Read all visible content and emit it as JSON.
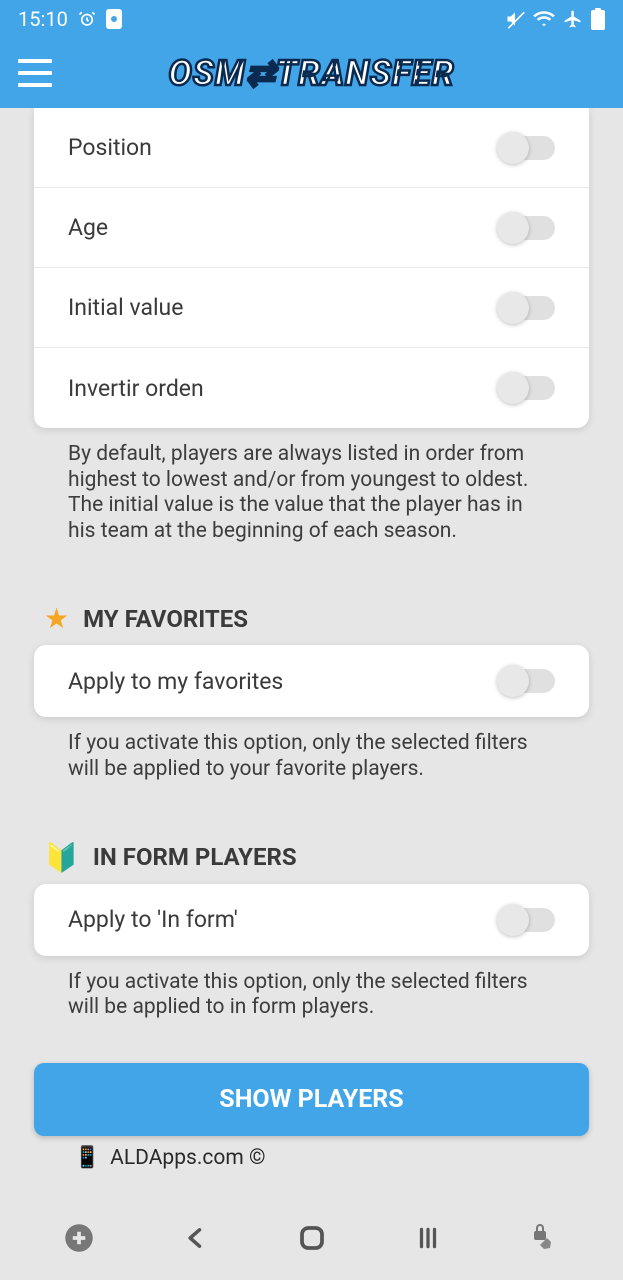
{
  "status": {
    "time": "15:10"
  },
  "app": {
    "title": "OSM⇄TRANSFER"
  },
  "sort": {
    "rows": [
      {
        "label": "Position"
      },
      {
        "label": "Age"
      },
      {
        "label": "Initial value"
      },
      {
        "label": "Invertir orden"
      }
    ],
    "help": "By default, players are always listed in order from highest to lowest and/or from youngest to oldest. The initial value is the value that the player has in his team at the beginning of each season."
  },
  "favorites": {
    "title": "MY FAVORITES",
    "apply_label": "Apply to my favorites",
    "help": "If you activate this option, only the selected filters will be applied to your favorite players."
  },
  "inform": {
    "title": "IN FORM PLAYERS",
    "apply_label": "Apply to 'In form'",
    "help": "If you activate this option, only the selected filters will be applied to in form players."
  },
  "actions": {
    "show_label": "SHOW PLAYERS"
  },
  "footer": {
    "credit": "ALDApps.com ©"
  }
}
